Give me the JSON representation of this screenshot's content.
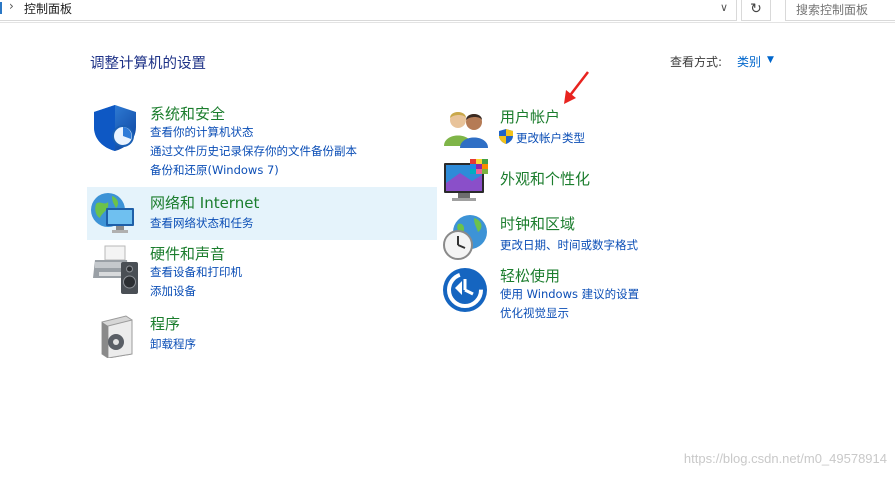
{
  "addressbar": {
    "separator": "›",
    "crumb": "控制面板",
    "dropdown_glyph": "∨",
    "refresh_glyph": "↻",
    "search_placeholder": "搜索控制面板"
  },
  "header": {
    "title": "调整计算机的设置",
    "view_by_label": "查看方式:",
    "view_by_value": "类别",
    "view_by_arrow": "▼"
  },
  "categories": {
    "system_security": {
      "title": "系统和安全",
      "links": [
        "查看你的计算机状态",
        "通过文件历史记录保存你的文件备份副本",
        "备份和还原(Windows 7)"
      ],
      "icon": "shield-icon"
    },
    "network": {
      "title": "网络和 Internet",
      "links": [
        "查看网络状态和任务"
      ],
      "icon": "network-globe-icon"
    },
    "hardware_sound": {
      "title": "硬件和声音",
      "links": [
        "查看设备和打印机",
        "添加设备"
      ],
      "icon": "printer-speaker-icon"
    },
    "programs": {
      "title": "程序",
      "links": [
        "卸载程序"
      ],
      "icon": "programs-box-icon"
    },
    "user_accounts": {
      "title": "用户帐户",
      "links": [
        "更改帐户类型"
      ],
      "icon": "users-icon",
      "link_icon": "uac-shield-icon"
    },
    "appearance": {
      "title": "外观和个性化",
      "links": [],
      "icon": "monitor-personalize-icon"
    },
    "clock_region": {
      "title": "时钟和区域",
      "links": [
        "更改日期、时间或数字格式"
      ],
      "icon": "clock-globe-icon"
    },
    "ease_of_access": {
      "title": "轻松使用",
      "links": [
        "使用 Windows 建议的设置",
        "优化视觉显示"
      ],
      "icon": "ease-of-access-icon"
    }
  },
  "annotation": {
    "arrow_color": "#e8231f"
  },
  "watermark": "https://blog.csdn.net/m0_49578914",
  "colors": {
    "title_blue": "#1e3287",
    "category_green": "#1b7d2d",
    "link_blue": "#0b4eb6",
    "hover_bg": "#e5f3fb"
  }
}
